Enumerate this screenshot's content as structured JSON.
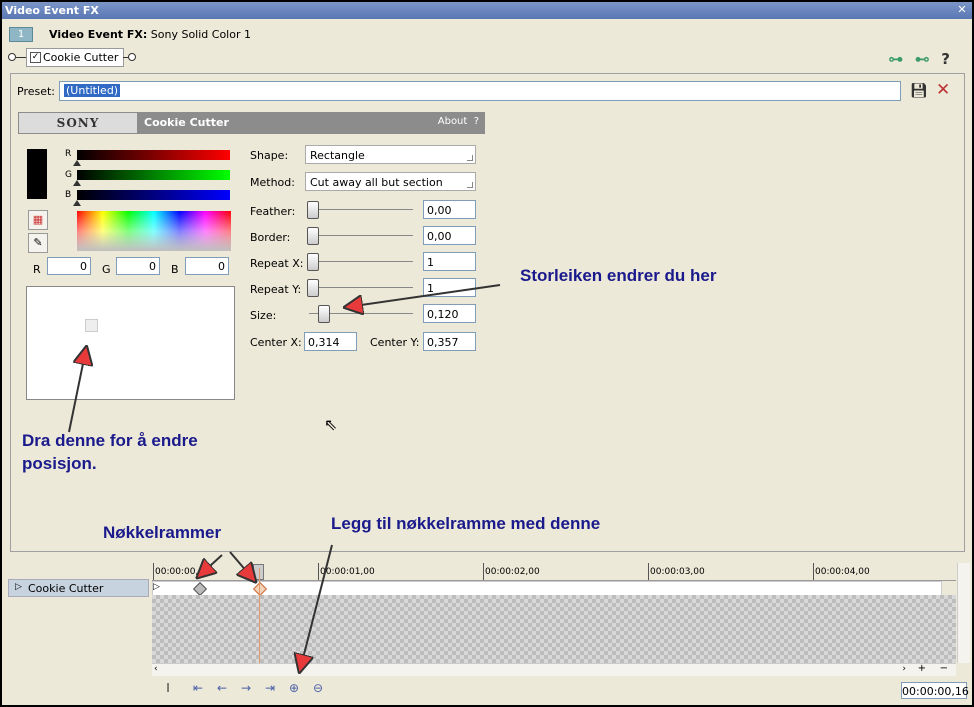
{
  "window": {
    "title": "Video Event FX"
  },
  "header": {
    "tab_number": "1",
    "label_bold": "Video Event FX:",
    "label_value": "Sony Solid Color 1"
  },
  "plugin_chain": {
    "plugin_name": "Cookie Cutter",
    "checked": true
  },
  "preset": {
    "label": "Preset:",
    "value": "(Untitled)"
  },
  "sony_bar": {
    "logo": "SONY",
    "plugin_name": "Cookie Cutter",
    "about": "About",
    "help": "?"
  },
  "color": {
    "channel_labels": [
      "R",
      "G",
      "B"
    ],
    "r_label": "R",
    "g_label": "G",
    "b_label": "B",
    "r_value": "0",
    "g_value": "0",
    "b_value": "0"
  },
  "params": {
    "shape_label": "Shape:",
    "shape_value": "Rectangle",
    "method_label": "Method:",
    "method_value": "Cut away all but section",
    "feather_label": "Feather:",
    "feather_value": "0,00",
    "border_label": "Border:",
    "border_value": "0,00",
    "repeatx_label": "Repeat X:",
    "repeatx_value": "1",
    "repeaty_label": "Repeat Y:",
    "repeaty_value": "1",
    "size_label": "Size:",
    "size_value": "0,120",
    "centerx_label": "Center X:",
    "centerx_value": "0,314",
    "centery_label": "Center Y:",
    "centery_value": "0,357"
  },
  "annotations": {
    "size_note": "Storleiken endrer du her",
    "drag_note_1": "Dra denne for å endre",
    "drag_note_2": "posisjon.",
    "keyframes_note": "Nøkkelrammer",
    "add_key_note": "Legg til nøkkelramme med denne"
  },
  "timeline": {
    "track_name": "Cookie Cutter",
    "ticks": [
      "00:00:00,00",
      "00:00:01,00",
      "00:00:02,00",
      "00:00:03,00",
      "00:00:04,00"
    ],
    "current_time": "00:00:00,16"
  },
  "colors": {
    "annotation": "#1a1a8c",
    "arrow_fill": "#e83a3a",
    "titlebar": "#5a77b4"
  }
}
